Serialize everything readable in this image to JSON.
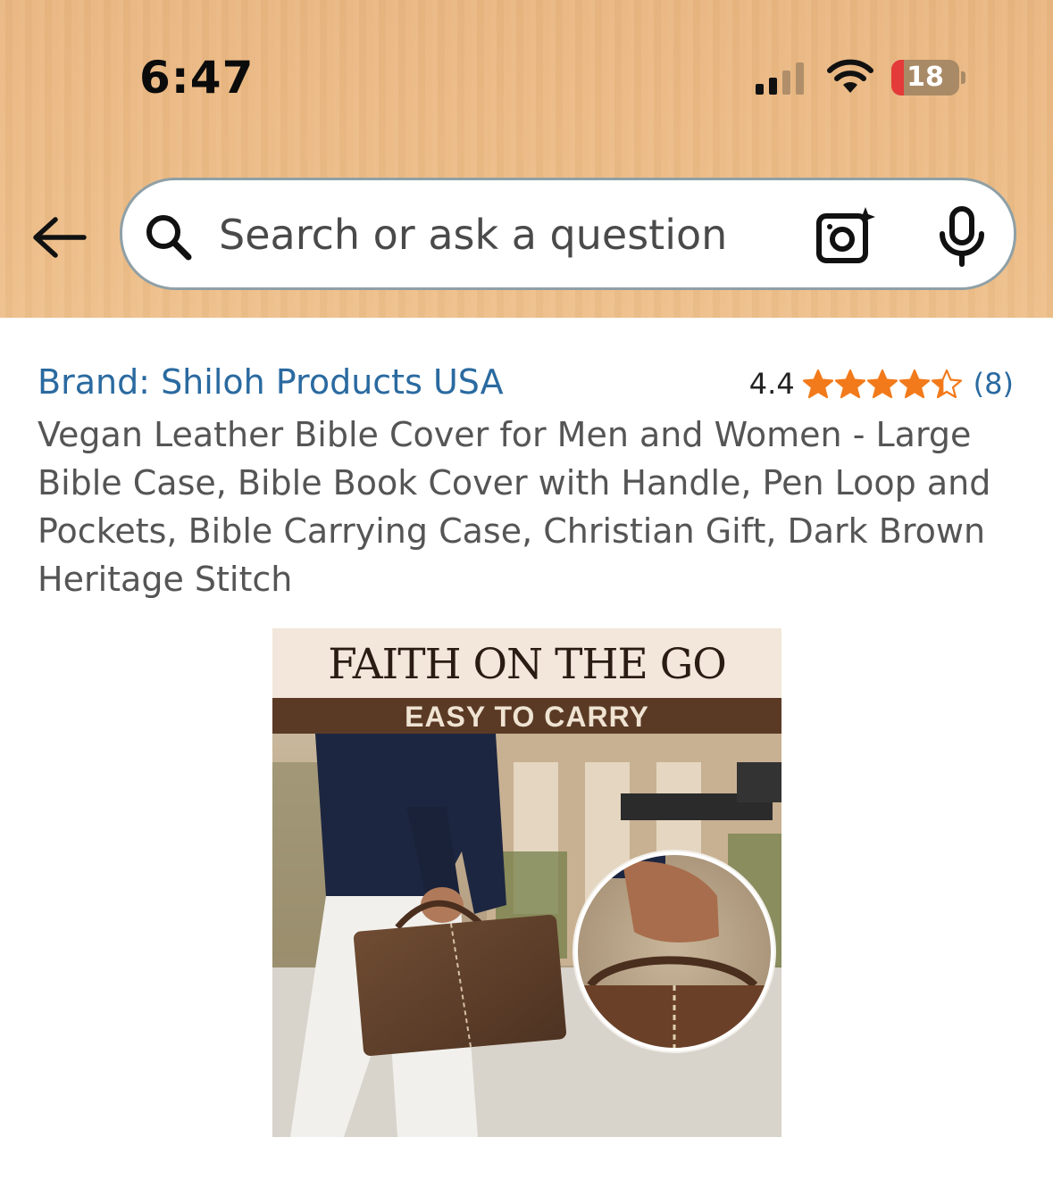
{
  "status_bar": {
    "time": "6:47",
    "battery_level": "18",
    "icons": [
      "cellular-signal-icon",
      "wifi-icon",
      "battery-icon"
    ]
  },
  "search": {
    "placeholder": "Search or ask a question",
    "icons": [
      "back-arrow-icon",
      "search-icon",
      "camera-icon",
      "microphone-icon"
    ]
  },
  "product": {
    "brand": "Brand: Shiloh Products USA",
    "rating": "4.4",
    "rating_value": 4.4,
    "rating_max": 5,
    "review_count": "(8)",
    "title": "Vegan Leather Bible Cover for Men and Women - Large Bible Case, Bible Book Cover with Handle, Pen Loop and Pockets, Bible Carrying Case, Christian Gift, Dark Brown Heritage Stitch",
    "image": {
      "headline": "FAITH ON THE GO",
      "subheadline": "EASY TO CARRY"
    }
  },
  "colors": {
    "header_bg": "#ecbb85",
    "link": "#2a6aa0",
    "star": "#f27a1a"
  }
}
